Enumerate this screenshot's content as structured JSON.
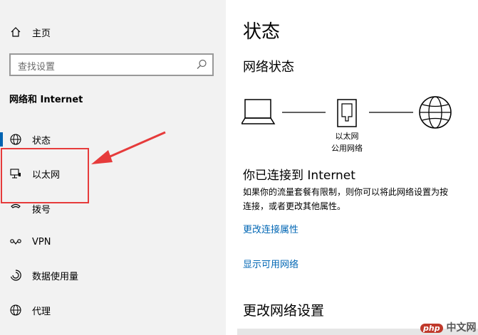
{
  "nav": {
    "home_label": "主页",
    "search_placeholder": "查找设置",
    "section_title": "网络和 Internet",
    "items": [
      {
        "label": "状态",
        "icon": "globe-icon"
      },
      {
        "label": "以太网",
        "icon": "ethernet-icon"
      },
      {
        "label": "拨号",
        "icon": "dialup-icon"
      },
      {
        "label": "VPN",
        "icon": "vpn-icon"
      },
      {
        "label": "数据使用量",
        "icon": "data-usage-icon"
      },
      {
        "label": "代理",
        "icon": "proxy-globe-icon"
      }
    ]
  },
  "content": {
    "title": "状态",
    "network_status_heading": "网络状态",
    "network_name": "以太网",
    "network_type": "公用网络",
    "connected_title": "你已连接到 Internet",
    "description": "如果你的流量套餐有限制，则你可以将此网络设置为按流量计费的连接，或者更改其他属性。",
    "description_line1": "如果你的流量套餐有限制，则你可以将此网络设置为按",
    "description_line2": "连接，或者更改其他属性。",
    "link_change_connection": "更改连接属性",
    "link_show_networks": "显示可用网络",
    "change_settings_heading": "更改网络设置"
  },
  "watermark": {
    "brand": "php",
    "text": "中文网"
  },
  "colors": {
    "accent": "#0063b1",
    "link": "#0066b4",
    "annotation": "#e63b3b",
    "nav_bg": "#f2f2f2"
  }
}
